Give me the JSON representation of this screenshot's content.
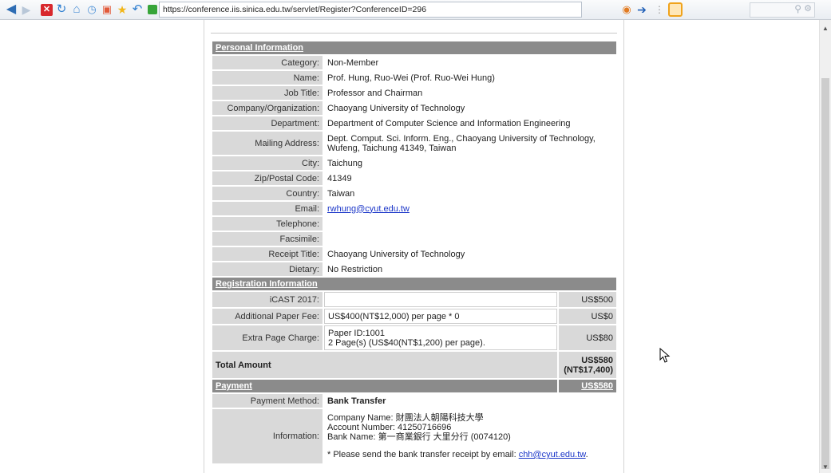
{
  "browser": {
    "url": "https://conference.iis.sinica.edu.tw/servlet/Register?ConferenceID=296",
    "icons": [
      "back-arrow-icon",
      "forward-arrow-icon",
      "stop-icon",
      "reload-icon",
      "home-icon",
      "history-icon",
      "pin-icon",
      "favorites-star-icon",
      "undo-icon",
      "lock-icon",
      "ie-compat-icon",
      "go-arrow-icon",
      "extension-icon",
      "search-icon",
      "gear-icon"
    ]
  },
  "personal": {
    "section_title": "Personal Information",
    "rows": [
      {
        "label": "Category:",
        "value": "Non-Member"
      },
      {
        "label": "Name:",
        "value": "Prof. Hung, Ruo-Wei (Prof. Ruo-Wei Hung)"
      },
      {
        "label": "Job Title:",
        "value": "Professor and Chairman"
      },
      {
        "label": "Company/Organization:",
        "value": "Chaoyang University of Technology"
      },
      {
        "label": "Department:",
        "value": "Department of Computer Science and Information Engineering"
      },
      {
        "label": "Mailing Address:",
        "value": "Dept. Comput. Sci. Inform. Eng., Chaoyang University of Technology, Wufeng, Taichung 41349, Taiwan"
      },
      {
        "label": "City:",
        "value": "Taichung"
      },
      {
        "label": "Zip/Postal Code:",
        "value": "41349"
      },
      {
        "label": "Country:",
        "value": "Taiwan"
      },
      {
        "label": "Email:",
        "value": "rwhung@cyut.edu.tw"
      },
      {
        "label": "Telephone:",
        "value": ""
      },
      {
        "label": "Facsimile:",
        "value": ""
      },
      {
        "label": "Receipt Title:",
        "value": "Chaoyang University of Technology"
      },
      {
        "label": "Dietary:",
        "value": "No Restriction"
      }
    ]
  },
  "registration": {
    "section_title": "Registration Information",
    "rows": [
      {
        "label": "iCAST 2017:",
        "value": "",
        "amount": "US$500"
      },
      {
        "label": "Additional Paper Fee:",
        "value": "US$400(NT$12,000) per page * 0",
        "amount": "US$0"
      },
      {
        "label": "Extra Page Charge:",
        "line1": "Paper ID:1001",
        "line2": "2 Page(s) (US$40(NT$1,200) per page).",
        "amount": "US$80"
      }
    ],
    "total_label": "Total Amount",
    "total_usd": "US$580",
    "total_ntd": "(NT$17,400)"
  },
  "payment": {
    "section_title": "Payment",
    "amount": "US$580",
    "method_label": "Payment Method:",
    "method_value": "Bank Transfer",
    "info_label": "Information:",
    "company": "Company Name: 財團法人朝陽科技大學",
    "account": "Account Number: 41250716696",
    "bank": "Bank Name: 第一商業銀行 大里分行 (0074120)",
    "note_prefix": "* Please send the bank transfer receipt by email: ",
    "note_email": "chh@cyut.edu.tw",
    "note_suffix": "."
  }
}
